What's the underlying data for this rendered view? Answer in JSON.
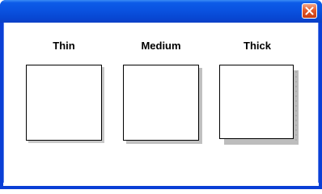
{
  "window": {
    "title": "",
    "close_label": "Close"
  },
  "panels": [
    {
      "label": "Thin"
    },
    {
      "label": "Medium"
    },
    {
      "label": "Thick"
    }
  ],
  "colors": {
    "titlebar": "#0a52e0",
    "close_button": "#e55a2b",
    "panel_border": "#000000",
    "shadow": "#c0c0c0"
  }
}
